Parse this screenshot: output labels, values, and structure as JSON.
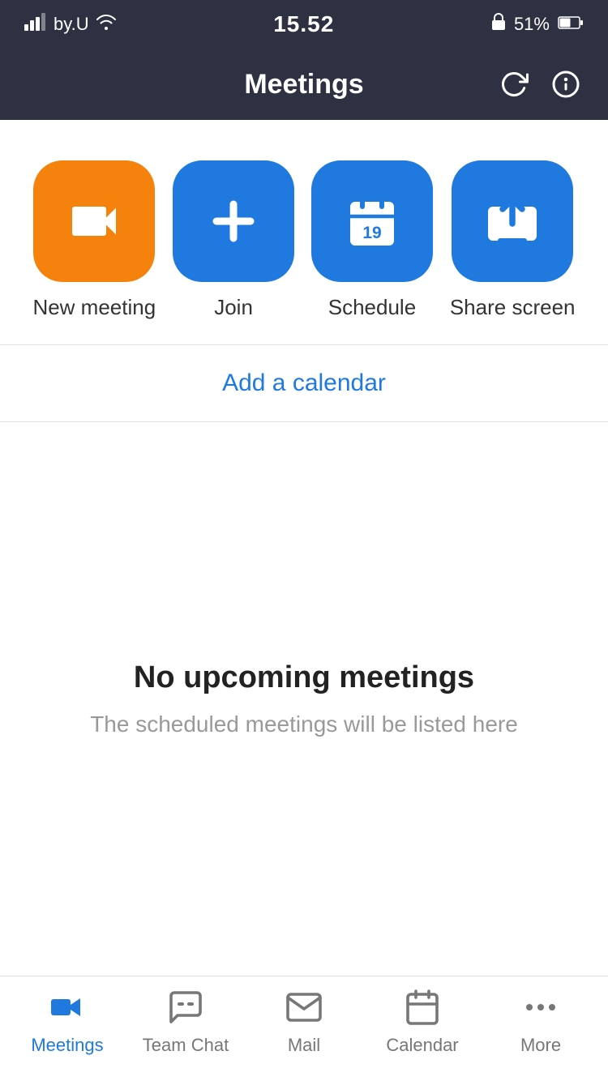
{
  "statusBar": {
    "carrier": "by.U",
    "time": "15.52",
    "battery": "51%"
  },
  "header": {
    "title": "Meetings",
    "refreshTitle": "refresh",
    "infoTitle": "info"
  },
  "actions": [
    {
      "id": "new-meeting",
      "label": "New meeting",
      "color": "orange",
      "icon": "video"
    },
    {
      "id": "join",
      "label": "Join",
      "color": "blue",
      "icon": "plus"
    },
    {
      "id": "schedule",
      "label": "Schedule",
      "color": "blue",
      "icon": "calendar"
    },
    {
      "id": "share-screen",
      "label": "Share screen",
      "color": "blue",
      "icon": "share"
    }
  ],
  "addCalendar": {
    "label": "Add a calendar"
  },
  "emptyState": {
    "title": "No upcoming meetings",
    "subtitle": "The scheduled meetings will be listed here"
  },
  "bottomNav": [
    {
      "id": "meetings",
      "label": "Meetings",
      "active": true
    },
    {
      "id": "team-chat",
      "label": "Team Chat",
      "active": false
    },
    {
      "id": "mail",
      "label": "Mail",
      "active": false
    },
    {
      "id": "calendar",
      "label": "Calendar",
      "active": false
    },
    {
      "id": "more",
      "label": "More",
      "active": false
    }
  ]
}
